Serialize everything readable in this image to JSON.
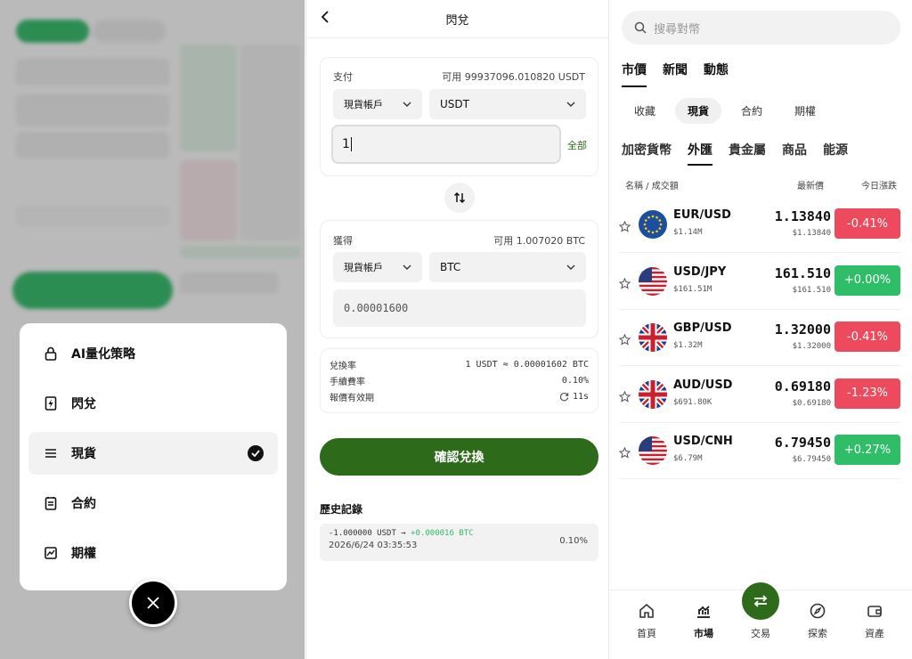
{
  "menu": {
    "items": [
      {
        "label": "AI量化策略",
        "icon": "lock-icon"
      },
      {
        "label": "閃兌",
        "icon": "flash-icon"
      },
      {
        "label": "現貨",
        "icon": "list-icon",
        "selected": true
      },
      {
        "label": "合約",
        "icon": "clipboard-icon"
      },
      {
        "label": "期權",
        "icon": "chart-box-icon"
      }
    ]
  },
  "swap": {
    "title": "閃兌",
    "pay": {
      "label": "支付",
      "available": "可用 99937096.010820 USDT",
      "account": "現貨帳戶",
      "currency": "USDT",
      "amount": "1",
      "all_label": "全部"
    },
    "receive": {
      "label": "獲得",
      "available": "可用 1.007020 BTC",
      "account": "現貨帳戶",
      "currency": "BTC",
      "amount": "0.00001600"
    },
    "info": {
      "rate_label": "兌換率",
      "rate_value": "1 USDT ≈ 0.00001602 BTC",
      "fee_label": "手續費率",
      "fee_value": "0.10%",
      "valid_label": "報價有效期",
      "valid_value": "11s"
    },
    "confirm_label": "確認兌換",
    "history_title": "歷史記錄",
    "history": [
      {
        "from": "-1.000000 USDT",
        "arrow": "→",
        "to": "+0.000016 BTC",
        "time": "2026/6/24 03:35:53",
        "fee": "0.10%"
      }
    ]
  },
  "market": {
    "search_placeholder": "搜尋對幣",
    "top_tabs": [
      "市價",
      "新聞",
      "動態"
    ],
    "sub_tabs": [
      "收藏",
      "現貨",
      "合約",
      "期權"
    ],
    "categories": [
      "加密貨幣",
      "外匯",
      "貴金屬",
      "商品",
      "能源"
    ],
    "col_name": "名稱 / 成交額",
    "col_price": "最新價",
    "col_change": "今日漲跌",
    "rows": [
      {
        "pair": "EUR/USD",
        "volume": "$1.14M",
        "price": "1.13840",
        "price2": "$1.13840",
        "change": "-0.41%",
        "dir": "dn",
        "flag": "eu"
      },
      {
        "pair": "USD/JPY",
        "volume": "$161.51M",
        "price": "161.510",
        "price2": "$161.510",
        "change": "+0.00%",
        "dir": "up",
        "flag": "us"
      },
      {
        "pair": "GBP/USD",
        "volume": "$1.32M",
        "price": "1.32000",
        "price2": "$1.32000",
        "change": "-0.41%",
        "dir": "dn",
        "flag": "uk"
      },
      {
        "pair": "AUD/USD",
        "volume": "$691.80K",
        "price": "0.69180",
        "price2": "$0.69180",
        "change": "-1.23%",
        "dir": "dn",
        "flag": "uk"
      },
      {
        "pair": "USD/CNH",
        "volume": "$6.79M",
        "price": "6.79450",
        "price2": "$6.79450",
        "change": "+0.27%",
        "dir": "up",
        "flag": "us"
      }
    ],
    "nav": [
      "首頁",
      "市場",
      "交易",
      "探索",
      "資產"
    ]
  },
  "colors": {
    "brand_green": "#2d6b1b",
    "up": "#2fbd67",
    "down": "#ee4a5d"
  }
}
